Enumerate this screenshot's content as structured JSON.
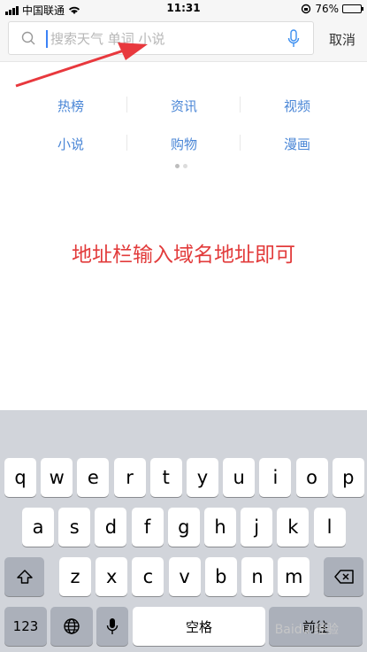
{
  "status": {
    "carrier": "中国联通",
    "time": "11:31",
    "battery": "76%",
    "battery_level": 0.76
  },
  "search": {
    "placeholder": "搜索天气 单词 小说",
    "cancel_label": "取消"
  },
  "categories": [
    [
      "热榜",
      "资讯",
      "视频"
    ],
    [
      "小说",
      "购物",
      "漫画"
    ]
  ],
  "annotation_text": "地址栏输入域名地址即可",
  "keyboard": {
    "row1": [
      "q",
      "w",
      "e",
      "r",
      "t",
      "y",
      "u",
      "i",
      "o",
      "p"
    ],
    "row2": [
      "a",
      "s",
      "d",
      "f",
      "g",
      "h",
      "j",
      "k",
      "l"
    ],
    "row3": [
      "z",
      "x",
      "c",
      "v",
      "b",
      "n",
      "m"
    ],
    "numbers_label": "123",
    "space_label": "空格",
    "go_label": "前往"
  },
  "watermark": "Baidu 经验",
  "colors": {
    "accent": "#4a86d6",
    "annotation": "#e23b3b",
    "arrow": "#e8383d"
  }
}
